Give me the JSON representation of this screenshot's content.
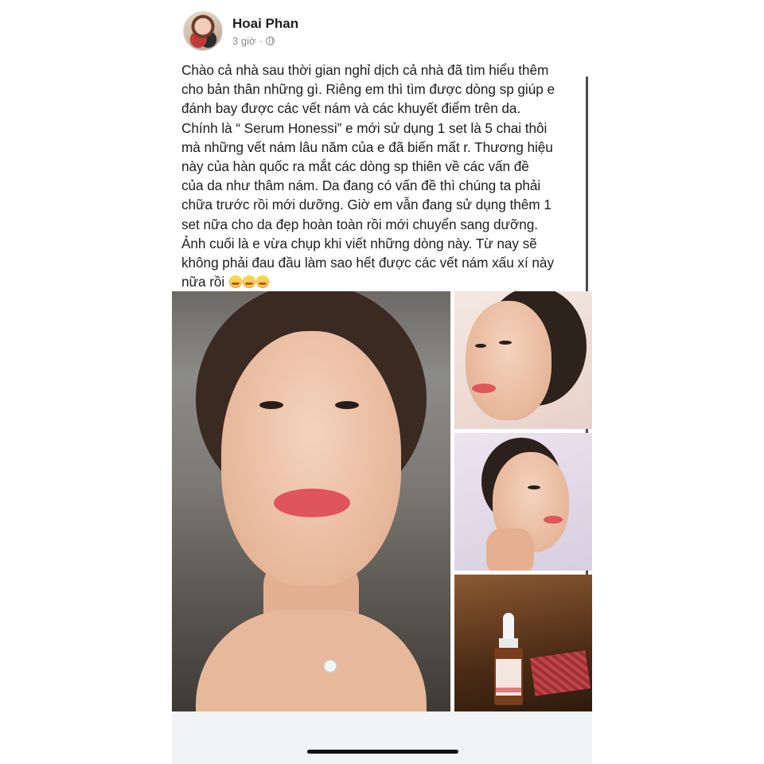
{
  "post": {
    "author": "Hoai Phan",
    "time": "3 giờ",
    "text": "Chào cả nhà sau thời gian nghỉ dịch cả nhà đã tìm hiểu thêm\ncho bản thân những gì. Riêng em thì tìm được dòng sp giúp e\nđánh bay được các vết nám và các khuyết điểm trên da.\nChính là “ Serum Honessi” e mới sử dụng 1 set là 5 chai thôi\nmà những vết nám lâu năm của e đã biến mất r. Thương hiệu\nnày của hàn quốc ra mắt các dòng sp thiên về các vấn đề\ncủa da như thâm nám. Da đang có vấn đề thì chúng ta phải\nchữa trước rồi mới dưỡng. Giờ em vẫn đang sử dụng thêm 1\nset nữa cho da đẹp hoàn toàn rồi mới chuyển sang dưỡng.\nẢnh cuối là e vừa chụp khi viết những dòng này. Từ nay sẽ\nkhông phải đau đầu làm sao hết được các vết nám xấu xí này\nnữa rồi"
  },
  "icons": {
    "privacy": "globe-icon",
    "emoji": "smiling-face-with-hearts-icon"
  },
  "colors": {
    "text": "#1c1e21",
    "meta": "#8a8d91"
  }
}
